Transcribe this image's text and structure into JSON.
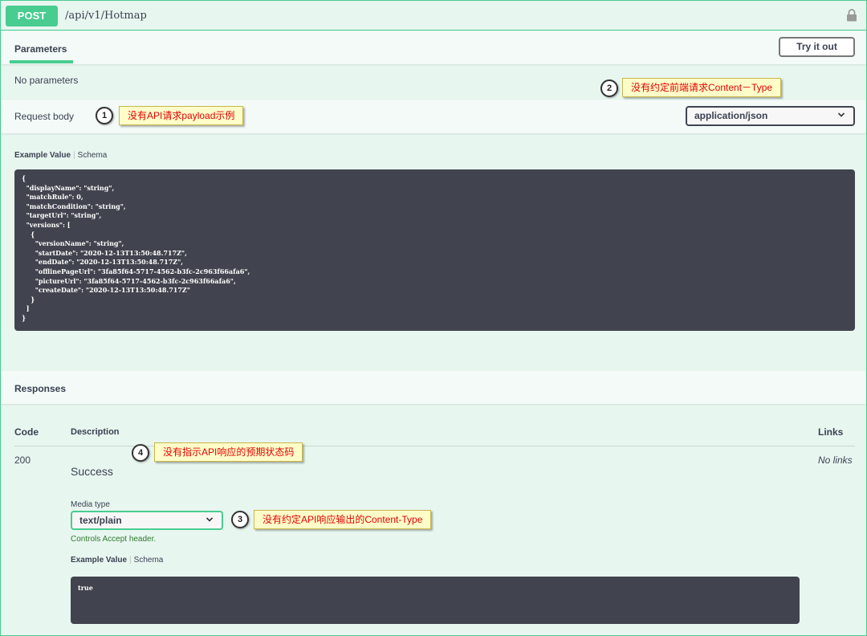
{
  "operation": {
    "method": "POST",
    "path": "/api/v1/Hotmap",
    "lock_icon": "lock-icon"
  },
  "parameters": {
    "tab_label": "Parameters",
    "try_button": "Try it out",
    "empty_text": "No parameters"
  },
  "request_body": {
    "label": "Request body",
    "content_type": "application/json",
    "example_label": "Example Value",
    "schema_label": "Schema",
    "example_lines": [
      "{",
      "  \"displayName\": \"string\",",
      "  \"matchRule\": 0,",
      "  \"matchCondition\": \"string\",",
      "  \"targetUrl\": \"string\",",
      "  \"versions\": [",
      "    {",
      "      \"versionName\": \"string\",",
      "      \"startDate\": \"2020-12-13T13:50:48.717Z\",",
      "      \"endDate\": \"2020-12-13T13:50:48.717Z\",",
      "      \"offlinePageUrl\": \"3fa85f64-5717-4562-b3fc-2c963f66afa6\",",
      "      \"pictureUrl\": \"3fa85f64-5717-4562-b3fc-2c963f66afa6\",",
      "      \"createDate\": \"2020-12-13T13:50:48.717Z\"",
      "    }",
      "  ]",
      "}"
    ]
  },
  "responses": {
    "title": "Responses",
    "col_code": "Code",
    "col_description": "Description",
    "col_links": "Links",
    "rows": [
      {
        "code": "200",
        "description": "Success",
        "links": "No links",
        "media_type_label": "Media type",
        "media_type": "text/plain",
        "controls_text": "Controls Accept header.",
        "example_label": "Example Value",
        "schema_label": "Schema",
        "example_value": "true"
      }
    ]
  },
  "callouts": [
    {
      "num": "1",
      "text": "没有API请求payload示例"
    },
    {
      "num": "2",
      "text": "没有约定前端请求Content－Type"
    },
    {
      "num": "3",
      "text": "没有约定API响应输出的Content-Type"
    },
    {
      "num": "4",
      "text": "没有指示API响应的预期状态码"
    }
  ],
  "colors": {
    "post_green": "#49cc90",
    "code_bg": "#41444e",
    "callout_bg": "#fffec9",
    "callout_text": "#e10000"
  }
}
